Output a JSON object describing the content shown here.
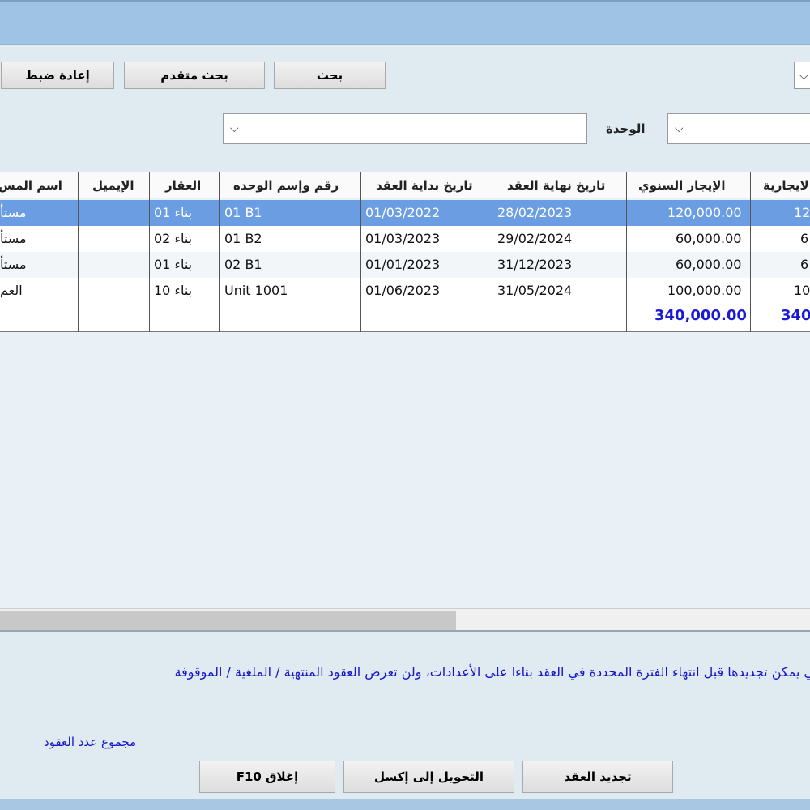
{
  "toolbar": {
    "reset_label": "إعادة ضبط",
    "advanced_search_label": "بحث متقدم",
    "search_label": "بحث"
  },
  "filters": {
    "unit_label": "الوحدة",
    "unit_value": "",
    "other_value": ""
  },
  "table": {
    "columns": [
      "اسم المس",
      "الإيميل",
      "العقار",
      "رقم وإسم الوحده",
      "تاريخ بداية العقد",
      "تاريخ نهاية العقد",
      "الإيجار السنوي",
      "لايجارية"
    ],
    "rows": [
      {
        "tenant": "مستأ",
        "email": "",
        "property": "بناء 01",
        "unit": "01 B1",
        "start": "01/03/2022",
        "end": "28/02/2023",
        "annual": "120,000.00",
        "extra": "12",
        "selected": true
      },
      {
        "tenant": "مستأ",
        "email": "",
        "property": "بناء 02",
        "unit": "01 B2",
        "start": "01/03/2023",
        "end": "29/02/2024",
        "annual": "60,000.00",
        "extra": "6",
        "selected": false
      },
      {
        "tenant": "مستأ",
        "email": "",
        "property": "بناء 01",
        "unit": "02 B1",
        "start": "01/01/2023",
        "end": "31/12/2023",
        "annual": "60,000.00",
        "extra": "6",
        "selected": false
      },
      {
        "tenant": "العم",
        "email": "",
        "property": "بناء 10",
        "unit": "Unit 1001",
        "start": "01/06/2023",
        "end": "31/05/2024",
        "annual": "100,000.00",
        "extra": "10",
        "selected": false
      }
    ],
    "total_annual": "340,000.00",
    "total_extra": "340"
  },
  "note": "التي يمكن تجديدها قبل انتهاء الفترة المحددة في العقد بناءا على الأعدادات، ولن تعرض العقود المنتهية / الملغية / الموقوفة",
  "footer": {
    "count_label": "مجموع عدد العقود",
    "close_label": "إغلاق F10",
    "excel_label": "التحويل إلى إكسل",
    "renew_label": "تجديد العقد"
  },
  "icons": {
    "dropdown": "chevron-down-icon"
  },
  "colors": {
    "selection": "#6a9de1",
    "total_text": "#1a1ad6",
    "note_text": "#1515c8"
  }
}
